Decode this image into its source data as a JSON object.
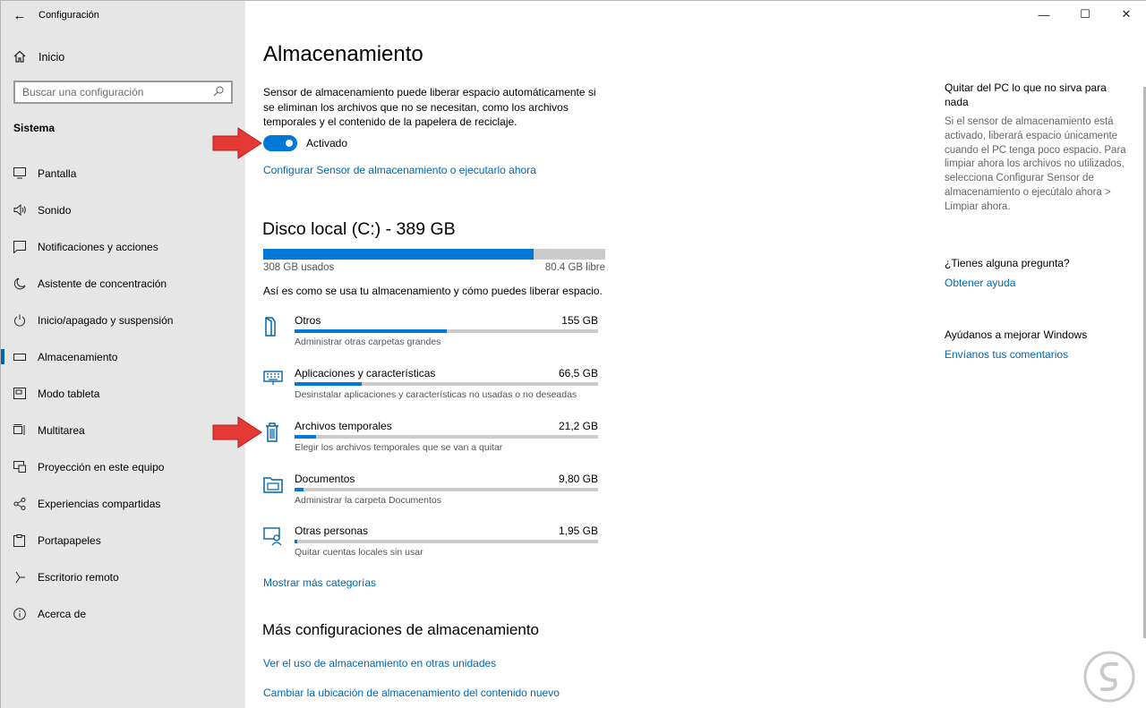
{
  "app": {
    "title": "Configuración",
    "back_icon": "back-arrow-icon"
  },
  "sidebar": {
    "home_label": "Inicio",
    "search_placeholder": "Buscar una configuración",
    "section_title": "Sistema",
    "items": [
      {
        "label": "Pantalla",
        "icon": "monitor-icon"
      },
      {
        "label": "Sonido",
        "icon": "speaker-icon"
      },
      {
        "label": "Notificaciones y acciones",
        "icon": "notification-icon"
      },
      {
        "label": "Asistente de concentración",
        "icon": "moon-icon"
      },
      {
        "label": "Inicio/apagado y suspensión",
        "icon": "power-icon"
      },
      {
        "label": "Almacenamiento",
        "icon": "storage-icon",
        "selected": true
      },
      {
        "label": "Modo tableta",
        "icon": "tablet-icon"
      },
      {
        "label": "Multitarea",
        "icon": "multitask-icon"
      },
      {
        "label": "Proyección en este equipo",
        "icon": "projection-icon"
      },
      {
        "label": "Experiencias compartidas",
        "icon": "share-icon"
      },
      {
        "label": "Portapapeles",
        "icon": "clipboard-icon"
      },
      {
        "label": "Escritorio remoto",
        "icon": "remote-icon"
      },
      {
        "label": "Acerca de",
        "icon": "info-icon"
      }
    ]
  },
  "main": {
    "title": "Almacenamiento",
    "description": "Sensor de almacenamiento puede liberar espacio automáticamente si se eliminan los archivos que no se necesitan, como los archivos temporales y el contenido de la papelera de reciclaje.",
    "toggle_label": "Activado",
    "toggle_on": true,
    "config_link": "Configurar Sensor de almacenamiento o ejecutarlo ahora",
    "disk": {
      "title": "Disco local (C:) - 389 GB",
      "used_label": "308 GB usados",
      "free_label": "80.4 GB libre",
      "used_fraction": 0.79
    },
    "usage_intro": "Así es como se usa tu almacenamiento y cómo puedes liberar espacio.",
    "categories": [
      {
        "name": "Otros",
        "size": "155 GB",
        "desc": "Administrar otras carpetas grandes",
        "fraction": 0.5,
        "icon": "folder-icon"
      },
      {
        "name": "Aplicaciones y características",
        "size": "66,5 GB",
        "desc": "Desinstalar aplicaciones y características no usadas o no deseadas",
        "fraction": 0.22,
        "icon": "keyboard-icon"
      },
      {
        "name": "Archivos temporales",
        "size": "21,2 GB",
        "desc": "Elegir los archivos temporales que se van a quitar",
        "fraction": 0.07,
        "icon": "trash-icon"
      },
      {
        "name": "Documentos",
        "size": "9,80 GB",
        "desc": "Administrar la carpeta Documentos",
        "fraction": 0.03,
        "icon": "documents-folder-icon"
      },
      {
        "name": "Otras personas",
        "size": "1,95 GB",
        "desc": "Quitar cuentas locales sin usar",
        "fraction": 0.01,
        "icon": "user-icon"
      }
    ],
    "more_categories_link": "Mostrar más categorías",
    "more_settings_title": "Más configuraciones de almacenamiento",
    "more_links": [
      "Ver el uso de almacenamiento en otras unidades",
      "Cambiar la ubicación de almacenamiento del contenido nuevo"
    ]
  },
  "right_panel": {
    "tip_title": "Quitar del PC lo que no sirva para nada",
    "tip_text": "Si el sensor de almacenamiento está activado, liberará espacio únicamente cuando el PC tenga poco espacio. Para limpiar ahora los archivos no utilizados, selecciona Configurar Sensor de almacenamiento o ejecútalo ahora > Limpiar ahora.",
    "question_title": "¿Tienes alguna pregunta?",
    "help_link": "Obtener ayuda",
    "improve_title": "Ayúdanos a mejorar Windows",
    "feedback_link": "Envíanos tus comentarios"
  },
  "window_controls": {
    "minimize": "—",
    "maximize": "☐",
    "close": "✕"
  },
  "colors": {
    "accent": "#0078d7",
    "link": "#0066b4",
    "sidebar_bg": "#e6e6e6",
    "arrow": "#e53935"
  }
}
